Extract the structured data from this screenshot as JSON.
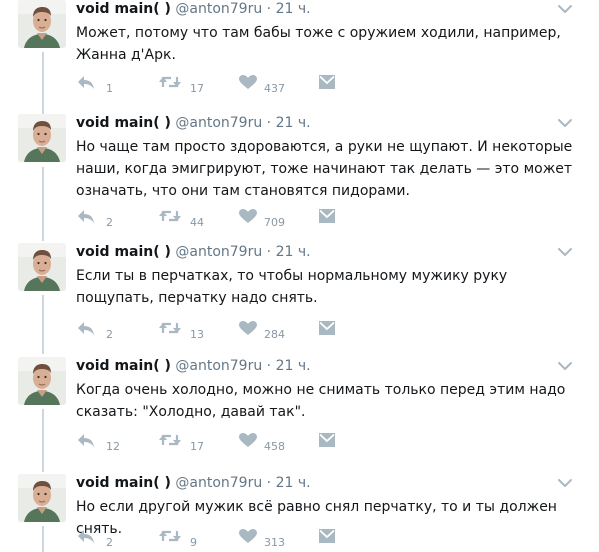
{
  "colors": {
    "icon_gray": "#aab8c2",
    "text_gray": "#657786",
    "count_gray": "#8899a6",
    "thread_line": "#ccd6dd"
  },
  "icons": {
    "reply": "reply-icon",
    "retweet": "retweet-icon",
    "like": "heart-icon",
    "dm": "envelope-icon",
    "menu": "chevron-down-icon"
  },
  "tweets": [
    {
      "name": "void main( )",
      "handle": "@anton79ru",
      "dot": "·",
      "time": "21 ч.",
      "text": "Может, потому что там бабы тоже с оружием ходили, например, Жанна д'Арк.",
      "replies": "1",
      "retweets": "17",
      "likes": "437"
    },
    {
      "name": "void main( )",
      "handle": "@anton79ru",
      "dot": "·",
      "time": "21 ч.",
      "text": "Но чаще там просто здороваются, а руки не щупают. И некоторые наши, когда эмигрируют, тоже начинают так делать — это может означать, что они там становятся пидорами.",
      "replies": "2",
      "retweets": "44",
      "likes": "709"
    },
    {
      "name": "void main( )",
      "handle": "@anton79ru",
      "dot": "·",
      "time": "21 ч.",
      "text": "Если ты в перчатках, то чтобы нормальному мужику руку пощупать, перчатку надо снять.",
      "replies": "2",
      "retweets": "13",
      "likes": "284"
    },
    {
      "name": "void main( )",
      "handle": "@anton79ru",
      "dot": "·",
      "time": "21 ч.",
      "text": "Когда очень холодно, можно не снимать только перед этим надо сказать: \"Холодно, давай так\".",
      "replies": "12",
      "retweets": "17",
      "likes": "458"
    },
    {
      "name": "void main( )",
      "handle": "@anton79ru",
      "dot": "·",
      "time": "21 ч.",
      "text": "Но если другой мужик всё равно снял перчатку, то и ты должен снять.",
      "replies": "2",
      "retweets": "9",
      "likes": "313"
    }
  ]
}
